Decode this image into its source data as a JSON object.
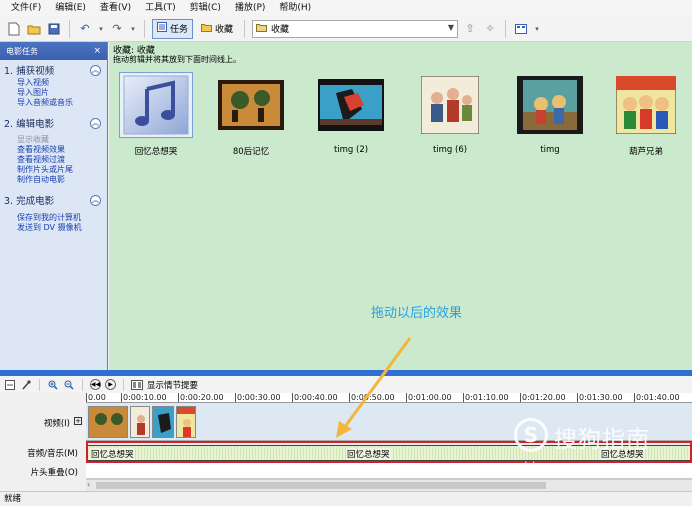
{
  "menubar": {
    "items": [
      "文件(F)",
      "编辑(E)",
      "查看(V)",
      "工具(T)",
      "剪辑(C)",
      "播放(P)",
      "帮助(H)"
    ]
  },
  "toolbar": {
    "tasks_label": "任务",
    "collections_label": "收藏",
    "collection_combo_value": "收藏"
  },
  "taskpane": {
    "header": "电影任务",
    "sections": [
      {
        "title": "1. 捕获视频",
        "links": [
          {
            "label": "导入视频",
            "enabled": true
          },
          {
            "label": "导入图片",
            "enabled": true
          },
          {
            "label": "导入音频或音乐",
            "enabled": true
          }
        ]
      },
      {
        "title": "2. 编辑电影",
        "links": [
          {
            "label": "显示收藏",
            "enabled": false
          },
          {
            "label": "查看视频效果",
            "enabled": true
          },
          {
            "label": "查看视频过渡",
            "enabled": true
          },
          {
            "label": "制作片头或片尾",
            "enabled": true
          },
          {
            "label": "制作自动电影",
            "enabled": true
          }
        ]
      },
      {
        "title": "3. 完成电影",
        "links": [
          {
            "label": "保存到我的计算机",
            "enabled": true
          },
          {
            "label": "发送到 DV 摄像机",
            "enabled": true
          }
        ]
      }
    ]
  },
  "collection": {
    "title": "收藏: 收藏",
    "hint": "拖动剪辑并将其放到下面时间线上。",
    "clips": [
      {
        "name": "回忆总想哭",
        "kind": "audio"
      },
      {
        "name": "80后记忆",
        "kind": "video"
      },
      {
        "name": "timg (2)",
        "kind": "video"
      },
      {
        "name": "timg (6)",
        "kind": "video"
      },
      {
        "name": "timg",
        "kind": "video"
      },
      {
        "name": "葫芦兄弟",
        "kind": "video"
      }
    ]
  },
  "annotation": "拖动以后的效果",
  "timeline": {
    "storyboard_label": "显示情节提要",
    "ruler_ticks": [
      "0.00",
      "0:00:10.00",
      "0:00:20.00",
      "0:00:30.00",
      "0:00:40.00",
      "0:00:50.00",
      "0:01:00.00",
      "0:01:10.00",
      "0:01:20.00",
      "0:01:30.00",
      "0:01:40.00"
    ],
    "tracks": {
      "video": "视频(I)",
      "audio": "音频/音乐(M)",
      "overlay": "片头重叠(O)"
    },
    "audio_clips": [
      "回忆总想哭",
      "回忆总想哭",
      "回忆总想哭"
    ]
  },
  "statusbar": "就绪",
  "watermark": {
    "text": "搜狗指南",
    "url": "zhinan.sogou.com"
  }
}
